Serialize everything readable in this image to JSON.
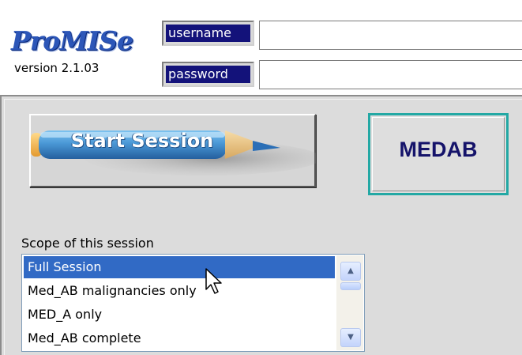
{
  "logo": {
    "title": "ProMISe",
    "version": "version 2.1.03"
  },
  "login": {
    "username_label": "username",
    "password_label": "password",
    "username_value": "",
    "password_value": ""
  },
  "buttons": {
    "start_session": "Start Session",
    "medab": "MEDAB"
  },
  "scope": {
    "label": "Scope of this session",
    "selected": "Full Session",
    "items": [
      {
        "label": "Full Session"
      },
      {
        "label": "Med_AB malignancies only"
      },
      {
        "label": "MED_A only"
      },
      {
        "label": "Med_AB complete"
      }
    ]
  },
  "icons": {
    "pencil": "pencil-icon",
    "cursor": "mouse-pointer-icon",
    "scroll_up": "chevron-up-icon",
    "scroll_down": "chevron-down-icon"
  },
  "colors": {
    "logo_blue": "#2c56b8",
    "label_navy": "#13127a",
    "medab_text": "#15136a",
    "medab_border": "#23a8a4",
    "selection": "#316ac5",
    "panel_grey": "#dcdcdc"
  }
}
